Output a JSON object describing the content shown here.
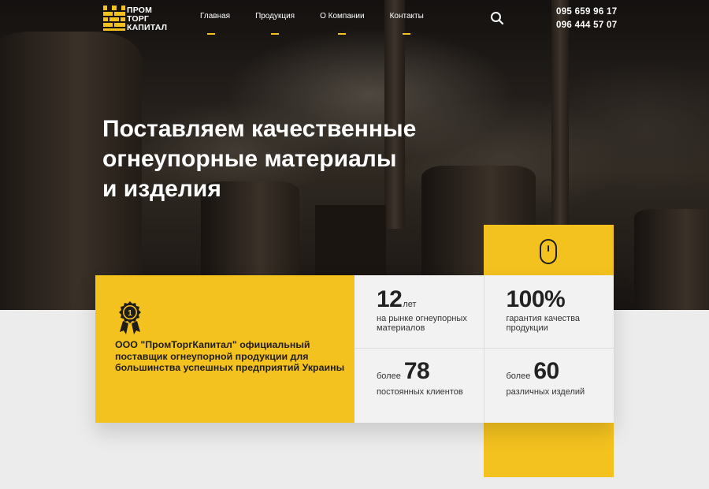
{
  "logo": {
    "line1": "ПРОМ",
    "line2": "ТОРГ",
    "line3": "КАПИТАЛ"
  },
  "nav": {
    "items": [
      {
        "label": "Главная"
      },
      {
        "label": "Продукция"
      },
      {
        "label": "О Компании"
      },
      {
        "label": "Контакты"
      }
    ],
    "search_icon": "search-icon"
  },
  "phones": [
    "095 659 96 17",
    "096 444 57 07"
  ],
  "hero": {
    "headline_line1": "Поставляем качественные",
    "headline_line2": "огнеупорные материалы",
    "headline_line3": "и изделия"
  },
  "about": {
    "badge_number": "1",
    "text": "ООО \"ПромТоргКапитал\" официальный поставщик огнеупорной продукции для большинства успешных предприятий Украины"
  },
  "stats": [
    {
      "prefix": "",
      "value": "12",
      "unit": "лет",
      "desc": "на рынке огнеупорных материалов"
    },
    {
      "prefix": "",
      "value": "100%",
      "unit": "",
      "desc": "гарантия качества продукции"
    },
    {
      "prefix": "более",
      "value": "78",
      "unit": "",
      "desc": "постоянных клиентов"
    },
    {
      "prefix": "более",
      "value": "60",
      "unit": "",
      "desc": "различных изделий"
    }
  ],
  "colors": {
    "accent": "#f4c21f",
    "dark": "#1f1d17",
    "panel": "#f2f2f2"
  },
  "icons": {
    "scroll": "mouse-scroll-icon",
    "award": "award-medal-icon",
    "logo": "brick-logo-icon"
  }
}
